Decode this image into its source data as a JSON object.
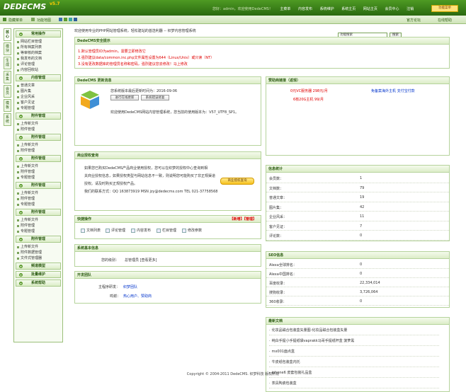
{
  "app": {
    "logo": "DEDECMS",
    "version": "v5.7",
    "badge": "SP1"
  },
  "topnav": {
    "user": "您好：admin，欢迎使用DedeCMS！",
    "items": [
      "主菜单",
      "内容发布",
      "系统维护",
      "系统主页",
      "网站主页",
      "会员中心",
      "注销"
    ],
    "style_button": "功能菜单"
  },
  "subbar": {
    "hide_menu": "隐藏菜单",
    "function_map": "功能地图",
    "search_placeholder": "功能搜索",
    "search_button": "搜索",
    "official_forum": "官方论坛",
    "help": "在线帮助"
  },
  "lefttabs": [
    "核心",
    "模块",
    "生成",
    "采集",
    "会员",
    "模板",
    "系统"
  ],
  "sidebar": {
    "groups": [
      {
        "title": "常用操作",
        "items": [
          "网站栏目管理",
          "所有档案列表",
          "等审核的档案",
          "我发布的文档",
          "评论管理",
          "内容回收站"
        ]
      },
      {
        "title": "内容管理",
        "items": [
          "普通文章",
          "图片集",
          "企业风采",
          "客户见证",
          "专题管理"
        ]
      },
      {
        "title": "附件管理",
        "items": [
          "上传新文件",
          "附件管理"
        ]
      },
      {
        "title": "附件管理",
        "items": [
          "上传新文件",
          "附件管理"
        ]
      },
      {
        "title": "附件管理",
        "items": [
          "上传新文件",
          "附件管理",
          "专题管理"
        ]
      },
      {
        "title": "附件管理",
        "items": [
          "上传新文件",
          "附件管理",
          "专题管理"
        ]
      },
      {
        "title": "附件管理",
        "items": [
          "上传新文件",
          "附件管理",
          "专题管理"
        ]
      },
      {
        "title": "附件管理",
        "items": [
          "上传新文件",
          "附件数据管理",
          "文件式管理器"
        ]
      },
      {
        "title": "频道模型",
        "items": []
      },
      {
        "title": "批量维护",
        "items": []
      },
      {
        "title": "系统帮助",
        "items": []
      }
    ]
  },
  "main": {
    "welcome": "欢迎使用专业的PHP网站管理系统，轻松建站的首选利器 -- 织梦内容管理系统",
    "security": {
      "title": "DedeCMS安全提示",
      "lines": [
        "1.默认管理员ID为admin，需要立即修改它",
        "2.强烈建议data/common.inc.php文件属性设置为644（Linux/Unix）或只读（NT）",
        "3.没有更改数据库的管理员名称和密码，强烈建议您去修改！马上修改"
      ]
    },
    "update": {
      "title": "DedeCMS 更新消息",
      "latest": "您系统版本最后更新时间为：2016-09-06",
      "btn_check": "进行在线更新",
      "btn_error": "系统错误修复",
      "desc": "欢迎使用DedeCMS网站内容管理系统，您当前的使用版本为：V57_UTF8_SP1。"
    },
    "business": {
      "title": "商业授权查询",
      "text": [
        "如果您已购买DedeCMS产品商业使用授权，您可以在织梦的授权中心查询到相",
        "关商业授权信息，如果授权类型与网站信息不一致，则说明您可能购买了非正规渠道",
        "授权。请及时购买正规授权产品。",
        "我们的联系方式：QQ 163873919 MSN jzy@dedecms.com TEL 021-37758568"
      ],
      "button": "商业授权查询"
    },
    "quick": {
      "title": "快捷操作",
      "new": "【新增】",
      "manage": "【管理】",
      "items": [
        "文档列表",
        "评论管理",
        "内容发布",
        "栏目管理",
        "修改参数"
      ]
    },
    "sysinfo": {
      "title": "系统基本信息",
      "label": "您的级别：",
      "value": "总管理员 [查看更多]"
    },
    "team": {
      "title": "开发团队",
      "rows": [
        {
          "k": "主程序研发：",
          "v": "织梦团队"
        },
        {
          "k": "鸣谢：",
          "v": "热心用户、赞助商"
        }
      ]
    },
    "sponsor": {
      "title": "赞助商链接（返现）",
      "links": [
        "0元VC服务器 298元/月",
        "免备案海外主机 支付宝付款",
        "6核20G主机 99/月"
      ]
    },
    "stats": {
      "title": "信息统计",
      "rows": [
        {
          "k": "会员数：",
          "v": "1"
        },
        {
          "k": "文档数：",
          "v": "79"
        },
        {
          "k": "普通文章：",
          "v": "19"
        },
        {
          "k": "图片集：",
          "v": "42"
        },
        {
          "k": "企业风采：",
          "v": "11"
        },
        {
          "k": "客户见证：",
          "v": "7"
        },
        {
          "k": "评论数：",
          "v": "0"
        }
      ]
    },
    "seo": {
      "title": "SEO信息",
      "rows": [
        {
          "k": "Alexa全球排名：",
          "v": "0"
        },
        {
          "k": "Alexa中国排名：",
          "v": "0"
        },
        {
          "k": "百度收录：",
          "v": "22,334,014"
        },
        {
          "k": "搜狗收录：",
          "v": "3,726,064"
        },
        {
          "k": "360收录：",
          "v": "0"
        }
      ]
    },
    "news": {
      "title": "最新文档",
      "items": [
        "化妆品磁合包装盒矢量图-化妆品磁合包装盒矢量",
        "纯白手提小手提纸袋vaprakk马哥手提纸杯盒 菠萝黑",
        "mx001面点盒",
        "牛皮纸包装盒内托",
        "iphone6 皮套包装礼品盒",
        "茶具陶瓷包装盒"
      ]
    }
  },
  "footer": "Copyright © 2004-2011 DedeCMS. 织梦科技 版权所有"
}
